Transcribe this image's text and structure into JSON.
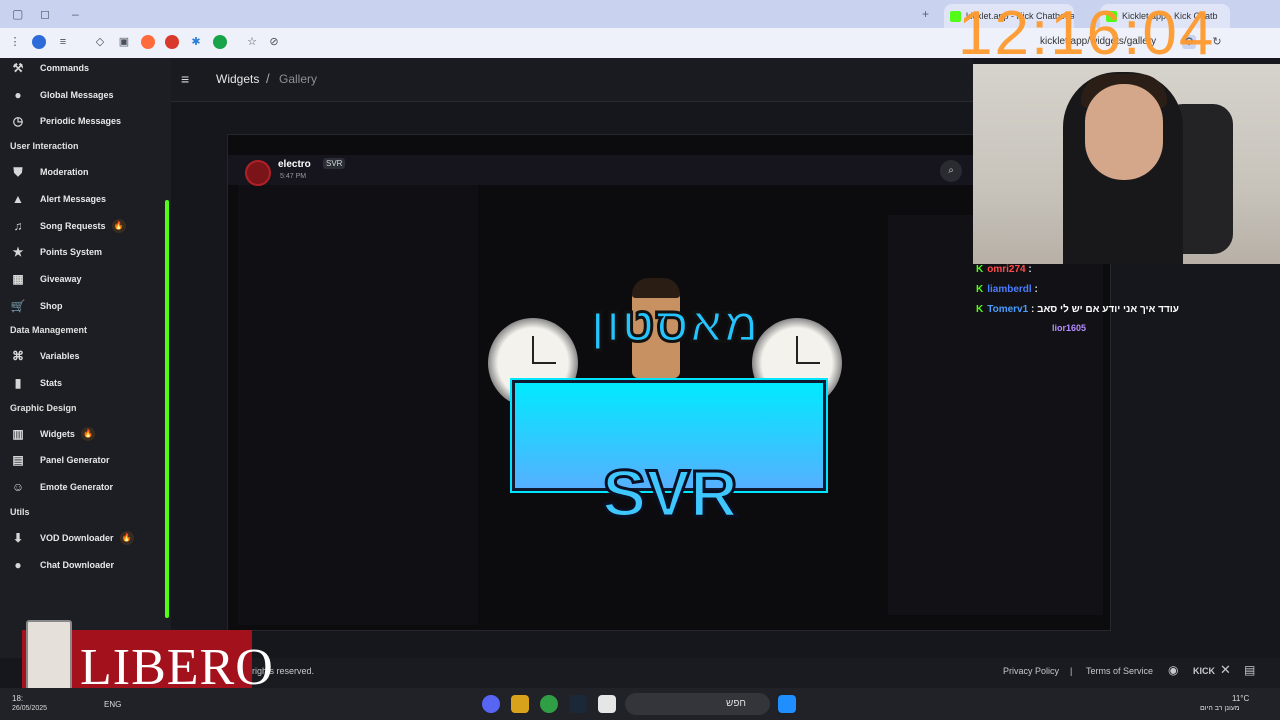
{
  "browser": {
    "tabs": [
      "kicklet.app - Kick Chatbot and",
      "Kicklet.app - Kick Chatb"
    ],
    "url": "kicklet.app/widgets/gallery"
  },
  "overlay": {
    "clock": "12:16:04",
    "chat": [
      {
        "user": "omri274",
        "text": ""
      },
      {
        "user": "liamberdl",
        "text": ""
      },
      {
        "user": "Tomerv1",
        "text": "עודד איך אני יודע אם יש לי סאב"
      },
      {
        "user": "lior1605",
        "text": ""
      }
    ]
  },
  "sidebar": {
    "items_top": [
      {
        "label": "Commands",
        "icon": "wrench-icon"
      },
      {
        "label": "Global Messages",
        "icon": "chat-bubble-icon"
      },
      {
        "label": "Periodic Messages",
        "icon": "clock-icon"
      }
    ],
    "sections": [
      {
        "title": "User Interaction",
        "items": [
          {
            "label": "Moderation",
            "icon": "shield-icon",
            "hot": false
          },
          {
            "label": "Alert Messages",
            "icon": "warning-icon",
            "hot": false
          },
          {
            "label": "Song Requests",
            "icon": "music-note-icon",
            "hot": true
          },
          {
            "label": "Points System",
            "icon": "star-icon",
            "hot": false
          },
          {
            "label": "Giveaway",
            "icon": "gift-icon",
            "hot": false
          },
          {
            "label": "Shop",
            "icon": "cart-icon",
            "hot": false
          }
        ]
      },
      {
        "title": "Data Management",
        "items": [
          {
            "label": "Variables",
            "icon": "variable-icon",
            "hot": false
          },
          {
            "label": "Stats",
            "icon": "bar-chart-icon",
            "hot": false
          }
        ]
      },
      {
        "title": "Graphic Design",
        "items": [
          {
            "label": "Widgets",
            "icon": "widget-icon",
            "hot": true
          },
          {
            "label": "Panel Generator",
            "icon": "panel-icon",
            "hot": false
          },
          {
            "label": "Emote Generator",
            "icon": "smile-icon",
            "hot": false
          }
        ]
      },
      {
        "title": "Utils",
        "items": [
          {
            "label": "VOD Downloader",
            "icon": "download-icon",
            "hot": true
          },
          {
            "label": "Chat Downloader",
            "icon": "chat-bubble-icon",
            "hot": false
          }
        ]
      }
    ]
  },
  "header": {
    "crumb_root": "Widgets",
    "separator": "/",
    "crumb_current": "Gallery"
  },
  "message": {
    "username": "electro",
    "badge": "SVR",
    "time": "5:47 PM"
  },
  "art": {
    "hebrew_title": "מאסטון",
    "banner_text": "SVR"
  },
  "footer": {
    "copyright": "rights reserved.",
    "privacy": "Privacy Policy",
    "sep": "|",
    "terms": "Terms of Service",
    "kick": "KICK"
  },
  "ad": {
    "brand": "LIBERO"
  },
  "taskbar": {
    "search_label": "חפש",
    "time": "18:",
    "date": "26/05/2025",
    "lang": "ENG",
    "weather": "11°C",
    "weather_desc": "מעונן רב היום"
  },
  "colors": {
    "accent": "#53fc18",
    "clock": "#ff9a2e",
    "banner": "#00eaff"
  }
}
